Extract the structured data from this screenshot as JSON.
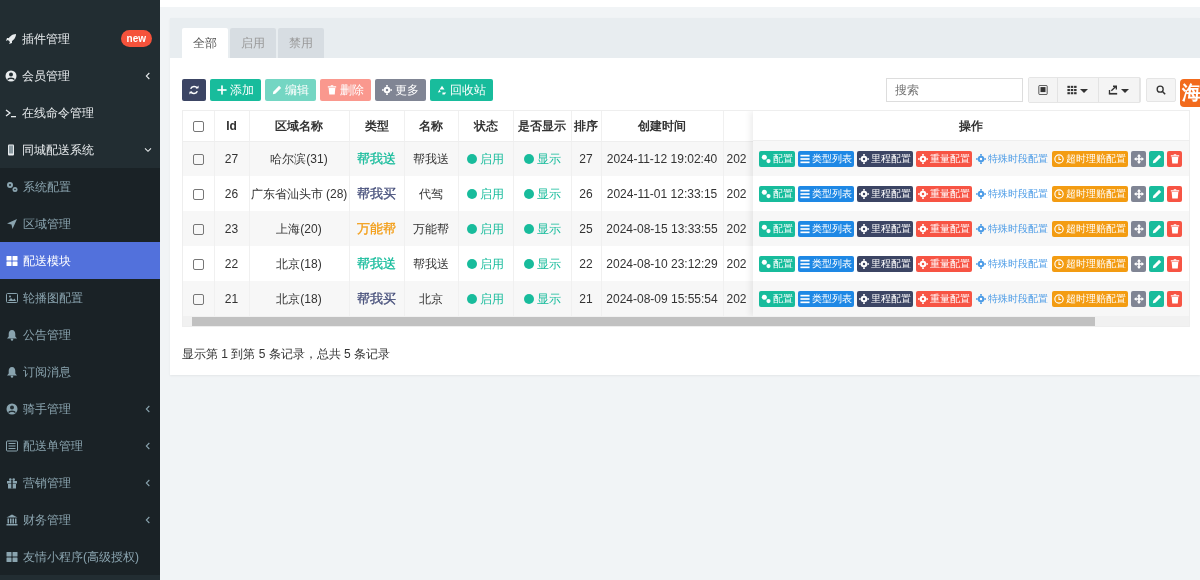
{
  "sidebar": {
    "items": [
      {
        "label": "插件管理",
        "badge": "new",
        "selected": false
      },
      {
        "label": "会员管理",
        "expanded": false,
        "selected": false
      },
      {
        "label": "在线命令管理",
        "selected": false
      },
      {
        "label": "同城配送系统",
        "expanded": true,
        "selected": false,
        "children": [
          {
            "label": "系统配置",
            "selected": false
          },
          {
            "label": "区域管理",
            "selected": false
          },
          {
            "label": "配送模块",
            "selected": true
          },
          {
            "label": "轮播图配置",
            "selected": false
          },
          {
            "label": "公告管理",
            "selected": false
          },
          {
            "label": "订阅消息",
            "selected": false
          },
          {
            "label": "骑手管理",
            "expanded": false,
            "selected": false
          },
          {
            "label": "配送单管理",
            "expanded": false,
            "selected": false
          },
          {
            "label": "营销管理",
            "expanded": false,
            "selected": false
          },
          {
            "label": "财务管理",
            "expanded": false,
            "selected": false
          },
          {
            "label": "友情小程序(高级授权)",
            "selected": false
          }
        ]
      }
    ]
  },
  "tabs": [
    {
      "label": "全部",
      "selected": true
    },
    {
      "label": "启用",
      "selected": false
    },
    {
      "label": "禁用",
      "selected": false
    }
  ],
  "toolbar": {
    "buttons": [
      {
        "kind": "refresh",
        "disabled": false
      },
      {
        "kind": "add",
        "label": "添加",
        "disabled": false
      },
      {
        "kind": "edit",
        "label": "编辑",
        "disabled": true
      },
      {
        "kind": "delete",
        "label": "删除",
        "disabled": true
      },
      {
        "kind": "more",
        "label": "更多",
        "disabled": false
      },
      {
        "kind": "recycle",
        "label": "回收站",
        "disabled": false
      }
    ],
    "search": {
      "placeholder": "搜索"
    },
    "tools": [
      {
        "kind": "card",
        "caret": false
      },
      {
        "kind": "columns",
        "caret": true
      },
      {
        "kind": "export",
        "caret": true
      },
      {
        "kind": "search",
        "caret": false
      }
    ]
  },
  "table": {
    "all_checked": false,
    "columns": [
      "Id",
      "区域名称",
      "类型",
      "名称",
      "状态",
      "是否显示",
      "排序",
      "创建时间"
    ],
    "actions_header": "操作",
    "rows": [
      {
        "checked": false,
        "id": "27",
        "region": "哈尔滨(31)",
        "type": {
          "label": "帮我送",
          "color": "#18bc9c"
        },
        "name": "帮我送",
        "status": "启用",
        "status_on": true,
        "display": "显示",
        "display_on": true,
        "sort": "27",
        "created": "2024-11-12 19:02:40",
        "column_10": "202",
        "actions": [
          {
            "kind": "config",
            "label": "配置"
          },
          {
            "kind": "types",
            "label": "类型列表"
          },
          {
            "kind": "mileage",
            "label": "里程配置"
          },
          {
            "kind": "weight",
            "label": "重量配置"
          },
          {
            "kind": "special",
            "label": "特殊时段配置"
          },
          {
            "kind": "timeout",
            "label": "超时理赔配置"
          },
          {
            "kind": "move"
          },
          {
            "kind": "edit"
          },
          {
            "kind": "delete"
          }
        ]
      },
      {
        "checked": false,
        "id": "26",
        "region": "广东省汕头市 (28)",
        "type": {
          "label": "帮我买",
          "color": "#444d79"
        },
        "name": "代驾",
        "status": "启用",
        "status_on": true,
        "display": "显示",
        "display_on": true,
        "sort": "26",
        "created": "2024-11-01 12:33:15",
        "column_10": "202",
        "actions": [
          {
            "kind": "config",
            "label": "配置"
          },
          {
            "kind": "types",
            "label": "类型列表"
          },
          {
            "kind": "mileage",
            "label": "里程配置"
          },
          {
            "kind": "weight",
            "label": "重量配置"
          },
          {
            "kind": "special",
            "label": "特殊时段配置"
          },
          {
            "kind": "timeout",
            "label": "超时理赔配置"
          },
          {
            "kind": "move"
          },
          {
            "kind": "edit"
          },
          {
            "kind": "delete"
          }
        ]
      },
      {
        "checked": false,
        "id": "23",
        "region": "上海(20)",
        "type": {
          "label": "万能帮",
          "color": "#f39c12"
        },
        "name": "万能帮",
        "status": "启用",
        "status_on": true,
        "display": "显示",
        "display_on": true,
        "sort": "25",
        "created": "2024-08-15 13:33:55",
        "column_10": "202",
        "actions": [
          {
            "kind": "config",
            "label": "配置"
          },
          {
            "kind": "types",
            "label": "类型列表"
          },
          {
            "kind": "mileage",
            "label": "里程配置"
          },
          {
            "kind": "weight",
            "label": "重量配置"
          },
          {
            "kind": "special",
            "label": "特殊时段配置"
          },
          {
            "kind": "timeout",
            "label": "超时理赔配置"
          },
          {
            "kind": "move"
          },
          {
            "kind": "edit"
          },
          {
            "kind": "delete"
          }
        ]
      },
      {
        "checked": false,
        "id": "22",
        "region": "北京(18)",
        "type": {
          "label": "帮我送",
          "color": "#18bc9c"
        },
        "name": "帮我送",
        "status": "启用",
        "status_on": true,
        "display": "显示",
        "display_on": true,
        "sort": "22",
        "created": "2024-08-10 23:12:29",
        "column_10": "202",
        "actions": [
          {
            "kind": "config",
            "label": "配置"
          },
          {
            "kind": "types",
            "label": "类型列表"
          },
          {
            "kind": "mileage",
            "label": "里程配置"
          },
          {
            "kind": "weight",
            "label": "重量配置"
          },
          {
            "kind": "special",
            "label": "特殊时段配置"
          },
          {
            "kind": "timeout",
            "label": "超时理赔配置"
          },
          {
            "kind": "move"
          },
          {
            "kind": "edit"
          },
          {
            "kind": "delete"
          }
        ]
      },
      {
        "checked": false,
        "id": "21",
        "region": "北京(18)",
        "type": {
          "label": "帮我买",
          "color": "#444d79"
        },
        "name": "北京",
        "status": "启用",
        "status_on": true,
        "display": "显示",
        "display_on": true,
        "sort": "21",
        "created": "2024-08-09 15:55:54",
        "column_10": "202",
        "actions": [
          {
            "kind": "config",
            "label": "配置"
          },
          {
            "kind": "types",
            "label": "类型列表"
          },
          {
            "kind": "mileage",
            "label": "里程配置"
          },
          {
            "kind": "weight",
            "label": "重量配置"
          },
          {
            "kind": "special",
            "label": "特殊时段配置"
          },
          {
            "kind": "timeout",
            "label": "超时理赔配置"
          },
          {
            "kind": "move"
          },
          {
            "kind": "edit"
          },
          {
            "kind": "delete"
          }
        ]
      }
    ]
  },
  "pagination": {
    "summary": "显示第 1 到第 5 条记录，总共 5 条记录"
  },
  "floating_badge": "海"
}
